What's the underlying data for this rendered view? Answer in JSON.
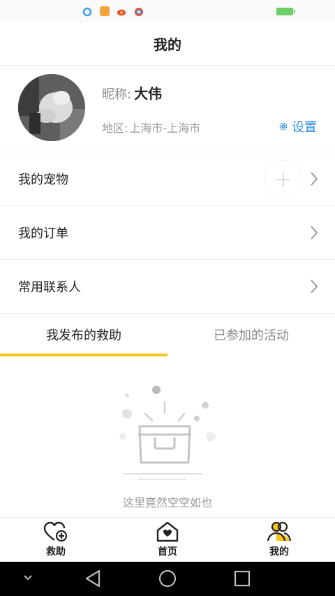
{
  "header": {
    "title": "我的"
  },
  "profile": {
    "nickname_label": "昵称:",
    "nickname": "大伟",
    "region_label": "地区:",
    "region": "上海市-上海市",
    "settings_label": "设置"
  },
  "menu": {
    "items": [
      {
        "label": "我的宠物"
      },
      {
        "label": "我的订单"
      },
      {
        "label": "常用联系人"
      }
    ]
  },
  "tabs": [
    {
      "label": "我发布的救助",
      "active": true
    },
    {
      "label": "已参加的活动",
      "active": false
    }
  ],
  "empty": {
    "text": "这里竟然空空如也"
  },
  "bottom_nav": [
    {
      "label": "救助",
      "icon": "heart-plus-icon"
    },
    {
      "label": "首页",
      "icon": "home-heart-icon"
    },
    {
      "label": "我的",
      "icon": "people-icon",
      "active": true
    }
  ],
  "colors": {
    "accent": "#f5c518",
    "link": "#2b8fe6"
  }
}
